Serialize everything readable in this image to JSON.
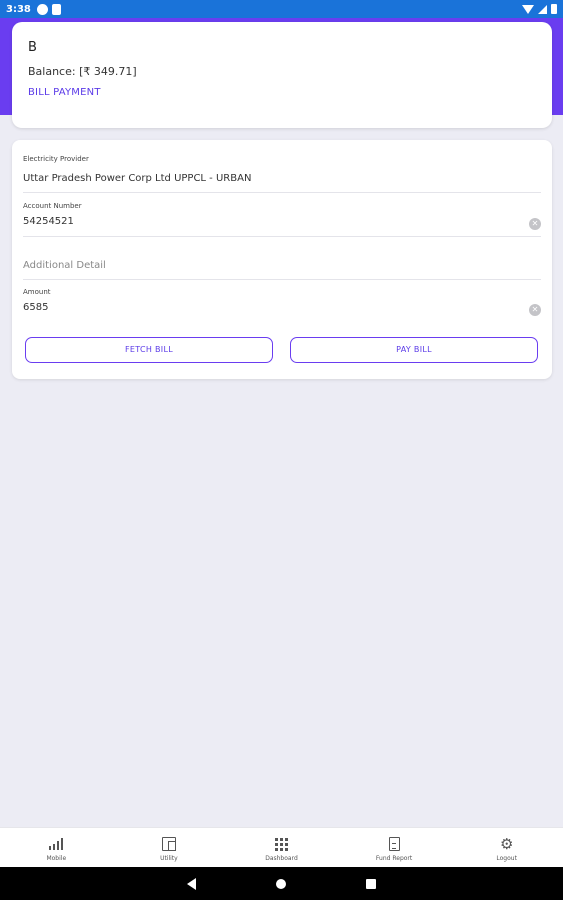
{
  "status_bar": {
    "time": "3:38"
  },
  "balance_card": {
    "initial": "B",
    "balance_text": "Balance: [₹ 349.71]",
    "bill_payment_label": "BILL PAYMENT"
  },
  "form": {
    "provider_label": "Electricity Provider",
    "provider_value": "Uttar Pradesh Power Corp Ltd UPPCL - URBAN",
    "account_label": "Account Number",
    "account_value": "54254521",
    "additional_placeholder": "Additional Detail",
    "amount_label": "Amount",
    "amount_value": "6585",
    "fetch_bill_label": "FETCH BILL",
    "pay_bill_label": "PAY BILL"
  },
  "bottom_nav": {
    "items": [
      {
        "label": "Mobile",
        "icon": "signal-bars-icon"
      },
      {
        "label": "Utility",
        "icon": "building-icon"
      },
      {
        "label": "Dashboard",
        "icon": "grid-icon"
      },
      {
        "label": "Fund Report",
        "icon": "document-icon"
      },
      {
        "label": "Logout",
        "icon": "gear-icon"
      }
    ]
  },
  "colors": {
    "accent": "#6a3df0",
    "status_bar": "#1a73d9",
    "background": "#ececf4"
  }
}
